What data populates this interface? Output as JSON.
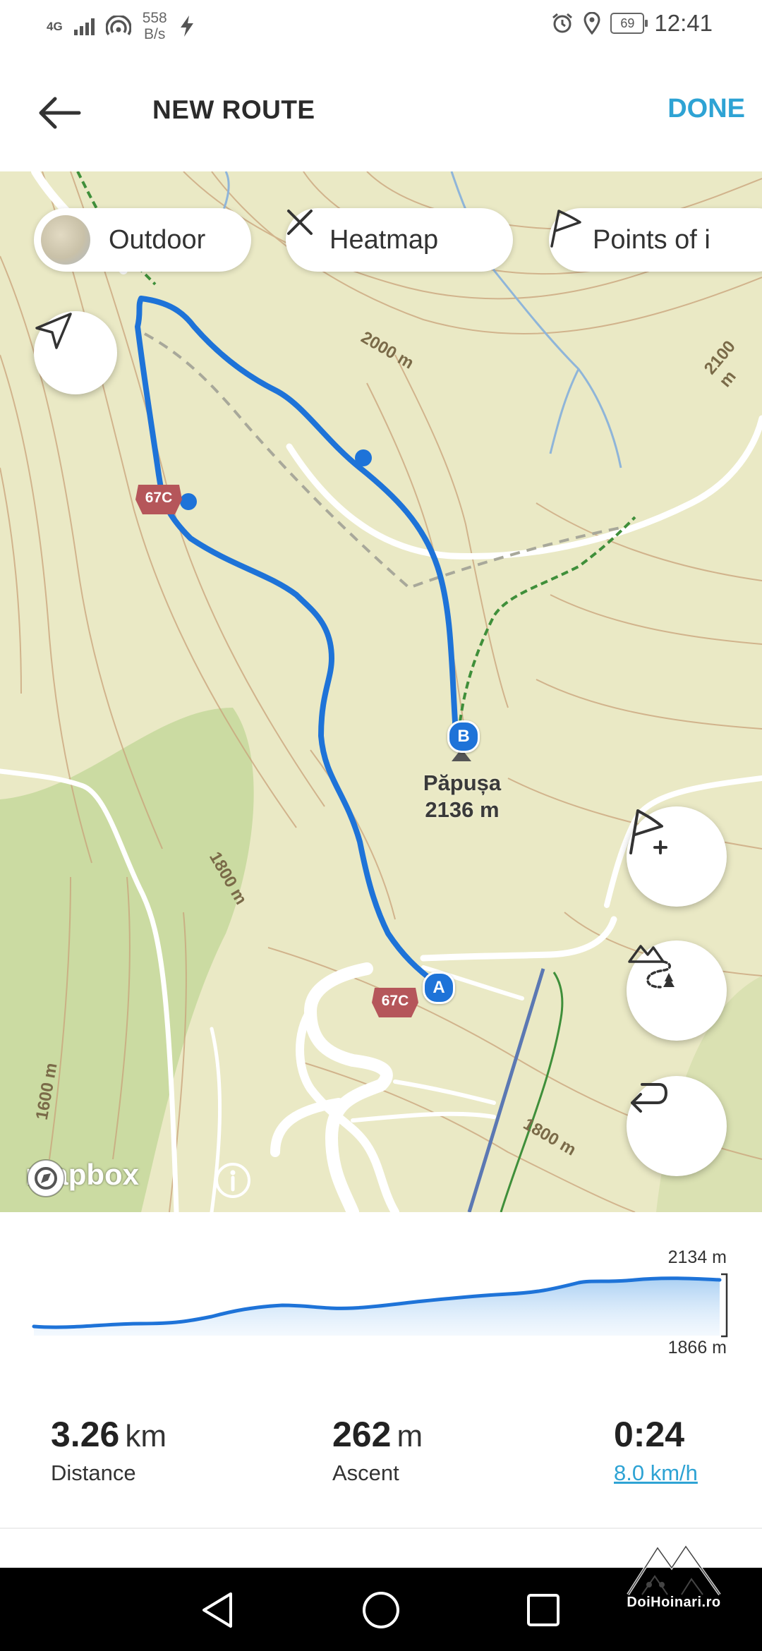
{
  "status_bar": {
    "network": "4G",
    "speed_value": "558",
    "speed_unit": "B/s",
    "battery": "69",
    "time": "12:41"
  },
  "header": {
    "title": "NEW ROUTE",
    "done_label": "DONE"
  },
  "map": {
    "chips": {
      "outdoor": "Outdoor",
      "heatmap": "Heatmap",
      "poi": "Points of i"
    },
    "contours": {
      "c2000": "2000 m",
      "c2100": "2100 m",
      "c1800_left": "1800 m",
      "c1600": "1600 m",
      "c1800_right": "1800 m"
    },
    "peak": {
      "name": "Păpușa",
      "elevation": "2136 m"
    },
    "road_shield": "67C",
    "start_marker": "A",
    "end_marker": "B",
    "attribution": "mapbox",
    "colors": {
      "route": "#1e73d8",
      "shield": "#b5565a",
      "trail_green": "#3f8f3a",
      "lift_blue": "#5b78b3"
    }
  },
  "elevation_profile": {
    "max_label": "2134 m",
    "min_label": "1866 m"
  },
  "stats": {
    "distance_value": "3.26",
    "distance_unit": "km",
    "distance_label": "Distance",
    "ascent_value": "262",
    "ascent_unit": "m",
    "ascent_label": "Ascent",
    "duration_value": "0:24",
    "speed_label": "8.0 km/h"
  },
  "watermark": {
    "text": "DoiHoinari.ro"
  }
}
